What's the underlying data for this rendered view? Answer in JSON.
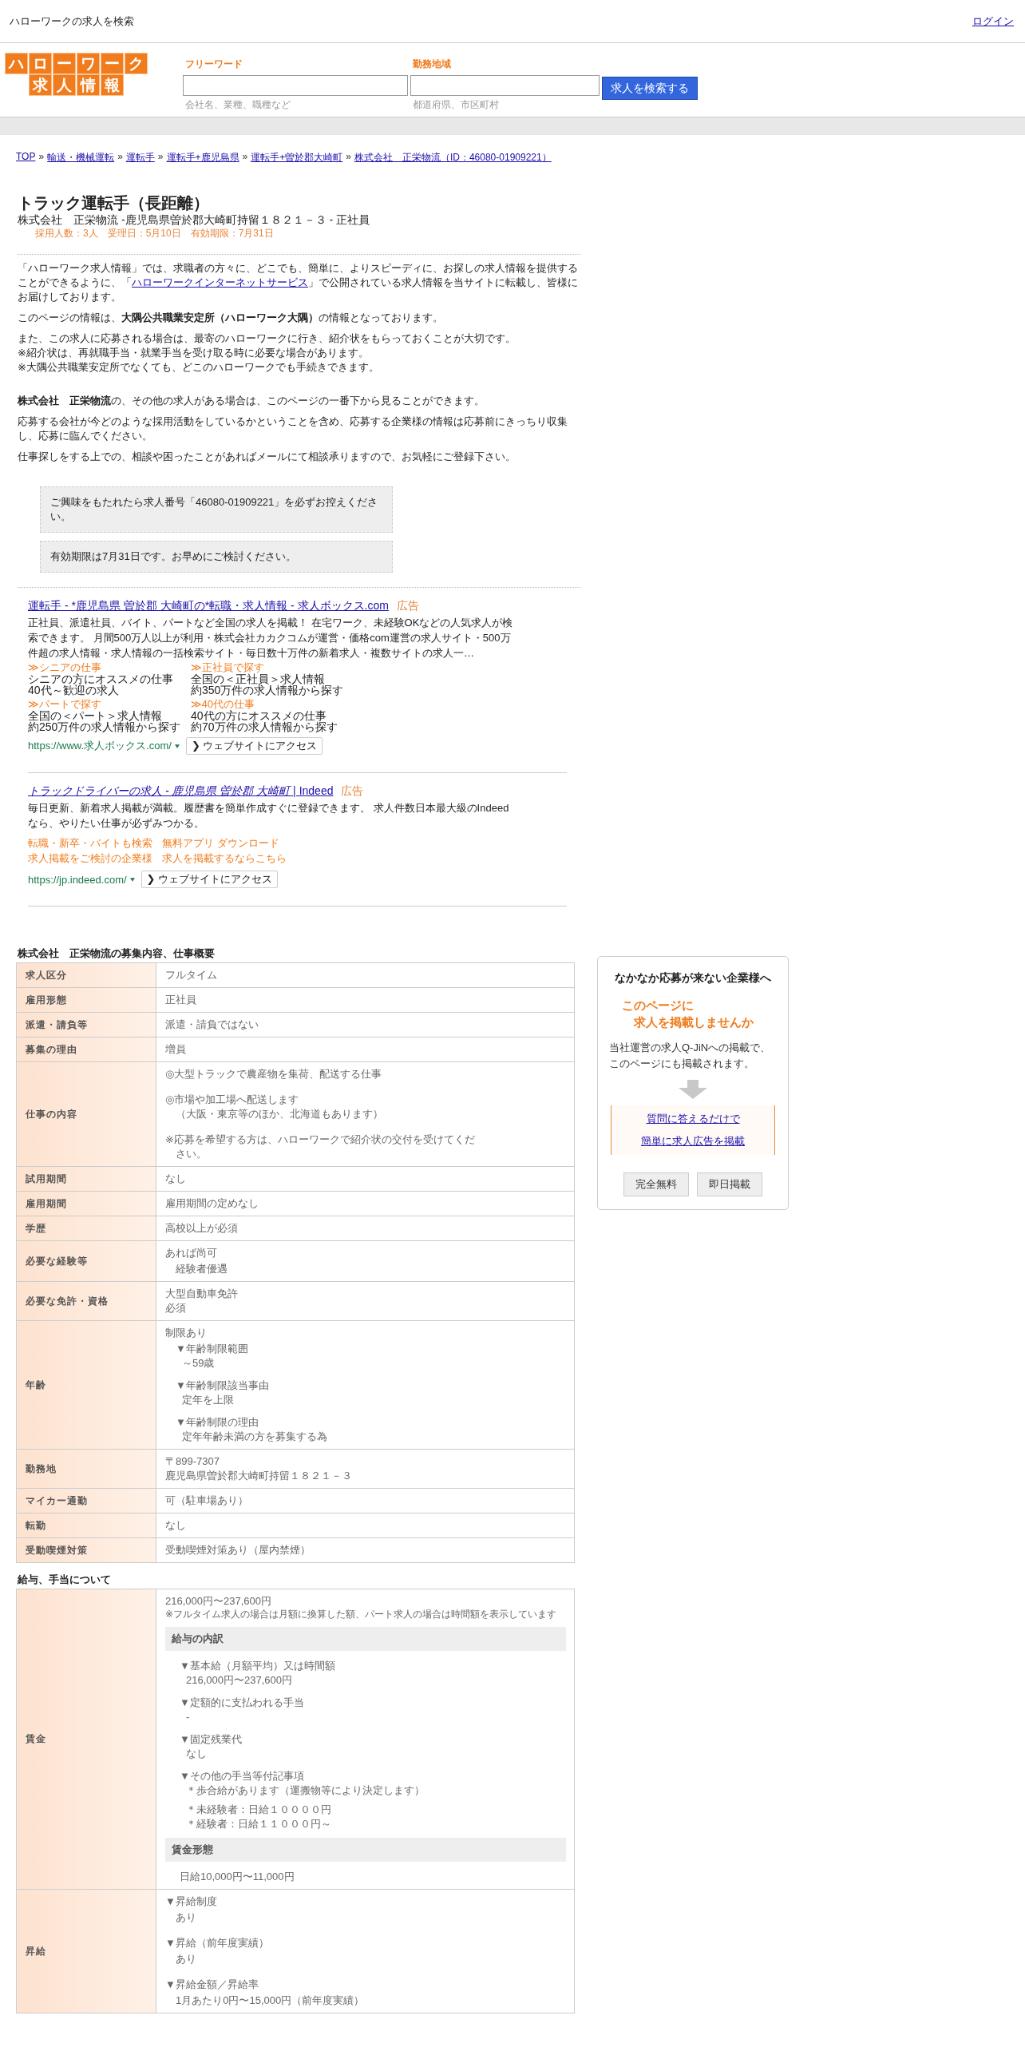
{
  "top_bar": {
    "title": "ハローワークの求人を検索",
    "login": "ログイン"
  },
  "logo": {
    "top": "ハローワーク",
    "bottom": "求人情報"
  },
  "search": {
    "fields": [
      {
        "label": "フリーワード",
        "note": "会社名、業種、職種など"
      },
      {
        "label": "勤務地域",
        "note": "都道府県、市区町村"
      }
    ],
    "button": "求人を検索する"
  },
  "breadcrumb": [
    {
      "kind": "link",
      "text": "TOP"
    },
    {
      "kind": "separator",
      "text": "»"
    },
    {
      "kind": "link",
      "text": "輸送・機械運転"
    },
    {
      "kind": "separator",
      "text": "»"
    },
    {
      "kind": "link",
      "text": "運転手"
    },
    {
      "kind": "separator",
      "text": "»"
    },
    {
      "kind": "link",
      "text": "運転手+鹿児島県"
    },
    {
      "kind": "separator",
      "text": "»"
    },
    {
      "kind": "link",
      "text": "運転手+曽於郡大崎町"
    },
    {
      "kind": "separator",
      "text": "»"
    },
    {
      "kind": "link",
      "text": "株式会社　正栄物流（ID：46080-01909221）"
    }
  ],
  "job": {
    "title": "トラック運転手（長距離）",
    "subtitle": "株式会社　正栄物流 -鹿児島県曽於郡大崎町持留１８２１－３ - 正社員",
    "meta": "採用人数：3人　受理日：5月10日　有効期限：7月31日"
  },
  "intro": [
    [
      {
        "text": "「ハローワーク求人情報」では、求職者の方々に、どこでも、簡単に、よりスピーディに、お探しの求人情報を提供することができるように、「",
        "link": "ハローワークインターネットサービス",
        "after": "」で公開されている求人情報を当サイトに転載し、皆様にお届けしております。"
      },
      {
        "text": "このページの情報は、**大隅公共職業安定所（ハローワーク大隅）**の情報となっております。"
      },
      {
        "lines": [
          "また、この求人に応募される場合は、最寄のハローワークに行き、紹介状をもらっておくことが大切です。",
          "※紹介状は、再就職手当・就業手当を受け取る時に必要な場合があります。",
          "※大隅公共職業安定所でなくても、どこのハローワークでも手続きできます。"
        ]
      }
    ],
    [
      {
        "text": "**株式会社　正栄物流**の、その他の求人がある場合は、このページの一番下から見ることができます。"
      },
      {
        "text": "応募する会社が今どのような採用活動をしているかということを含め、応募する企業様の情報は応募前にきっちり収集し、応募に臨んでください。"
      },
      {
        "text": "仕事探しをする上での、相談や困ったことがあればメールにて相談承りますので、お気軽にご登録下さい。"
      }
    ]
  ],
  "notices": [
    "ご興味をもたれたら求人番号「46080-01909221」を必ずお控えください。",
    "有効期限は7月31日です。お早めにご検討ください。"
  ],
  "ads": [
    {
      "kind": "sitelinks",
      "title": "運転手 - *鹿児島県 曽於郡 大崎町の*転職・求人情報 - 求人ボックス.com",
      "label": "広告",
      "description": "正社員、派遣社員、バイト、パートなど全国の求人を掲載！ 在宅ワーク、未経験OKなどの人気求人が検索できます。 月間500万人以上が利用・株式会社カカクコムが運営・価格com運営の求人サイト・500万件超の求人情報・求人情報の一括検索サイト・毎日数十万件の新着求人・複数サイトの求人一…",
      "sitelinks": [
        {
          "title": "≫シニアの仕事",
          "lines": [
            "シニアの方にオススメの仕事",
            "40代～歓迎の求人"
          ]
        },
        {
          "title": "≫正社員で探す",
          "lines": [
            "全国の＜正社員＞求人情報",
            "約350万件の求人情報から探す"
          ]
        },
        {
          "title": "≫パートで探す",
          "lines": [
            "全国の＜パート＞求人情報",
            "約250万件の求人情報から探す"
          ]
        },
        {
          "title": "≫40代の仕事",
          "lines": [
            "40代の方にオススメの仕事",
            "約70万件の求人情報から探す"
          ]
        }
      ],
      "url": "https://www.求人ボックス.com/",
      "button": "❯ ウェブサイトにアクセス"
    },
    {
      "kind": "links",
      "title": "*トラックドライバーの求人 - 鹿児島県 曽於郡 大崎町* | Indeed",
      "label": "広告",
      "description": "毎日更新、新着求人掲載が満載。履歴書を簡単作成すぐに登録できます。 求人件数日本最大級のIndeedなら、やりたい仕事が必ずみつかる。",
      "links": [
        [
          "転職・新卒・バイトも検索",
          "無料アプリ ダウンロード"
        ],
        [
          "求人掲載をご検討の企業様",
          "求人を掲載するならこちら"
        ]
      ],
      "url": "https://jp.indeed.com/",
      "button": "❯ ウェブサイトにアクセス"
    }
  ],
  "summary": {
    "heading": "株式会社　正栄物流の募集内容、仕事概要",
    "rows": [
      {
        "label": "求人区分",
        "blocks": [
          {
            "text": "フルタイム"
          }
        ]
      },
      {
        "label": "雇用形態",
        "blocks": [
          {
            "text": "正社員"
          }
        ]
      },
      {
        "label": "派遣・請負等",
        "blocks": [
          {
            "text": "派遣・請負ではない"
          }
        ]
      },
      {
        "label": "募集の理由",
        "blocks": [
          {
            "text": "増員"
          }
        ]
      },
      {
        "label": "仕事の内容",
        "blocks": [
          {
            "text": "◎大型トラックで農産物を集荷、配送する仕事"
          },
          {
            "lines": [
              "◎市場や加工場へ配送します",
              "　（大阪・東京等のほか、北海道もあります）"
            ]
          },
          {
            "lines": [
              "※応募を希望する方は、ハローワークで紹介状の交付を受けてくだ",
              "　さい。"
            ]
          }
        ]
      },
      {
        "label": "試用期間",
        "blocks": [
          {
            "text": "なし"
          }
        ]
      },
      {
        "label": "雇用期間",
        "blocks": [
          {
            "text": "雇用期間の定めなし"
          }
        ]
      },
      {
        "label": "学歴",
        "blocks": [
          {
            "text": "高校以上が必須"
          }
        ]
      },
      {
        "label": "必要な経験等",
        "blocks": [
          {
            "text": "あれば尚可",
            "children": [
              {
                "text": "経験者優遇"
              }
            ]
          }
        ]
      },
      {
        "label": "必要な免許・資格",
        "blocks": [
          {
            "lines": [
              "大型自動車免許",
              "必須"
            ]
          }
        ]
      },
      {
        "label": "年齢",
        "blocks": [
          {
            "text": "制限あり",
            "children": [
              {
                "text": "▼年齢制限範囲",
                "children": [
                  {
                    "text": "～59歳"
                  }
                ]
              },
              {
                "text": "▼年齢制限該当事由",
                "children": [
                  {
                    "text": "定年を上限"
                  }
                ]
              },
              {
                "text": "▼年齢制限の理由",
                "children": [
                  {
                    "text": "定年年齢未満の方を募集する為"
                  }
                ]
              }
            ]
          }
        ]
      },
      {
        "label": "勤務地",
        "blocks": [
          {
            "lines": [
              "〒899-7307",
              "鹿児島県曽於郡大崎町持留１８２１－３"
            ]
          }
        ]
      },
      {
        "label": "マイカー通勤",
        "blocks": [
          {
            "text": "可（駐車場あり）"
          }
        ]
      },
      {
        "label": "転勤",
        "blocks": [
          {
            "text": "なし"
          }
        ]
      },
      {
        "label": "受動喫煙対策",
        "blocks": [
          {
            "text": "受動喫煙対策あり（屋内禁煙）"
          }
        ]
      }
    ]
  },
  "salary": {
    "heading": "給与、手当について",
    "rows": [
      {
        "label": "賃金",
        "blocks": [
          {
            "kind": "text",
            "text": "216,000円〜237,600円"
          },
          {
            "kind": "note",
            "text": "※フルタイム求人の場合は月額に換算した額、パート求人の場合は時間額を表示しています"
          },
          {
            "kind": "subheading",
            "text": "給与の内訳",
            "children": [
              {
                "text": "▼基本給（月額平均）又は時間額",
                "children": [
                  {
                    "text": "216,000円〜237,600円"
                  }
                ]
              },
              {
                "text": "▼定額的に支払われる手当",
                "children": [
                  {
                    "text": "-"
                  }
                ]
              },
              {
                "text": "▼固定残業代",
                "children": [
                  {
                    "text": "なし"
                  }
                ]
              },
              {
                "text": "▼その他の手当等付記事項",
                "children": [
                  {
                    "text": "＊歩合給があります（運搬物等により決定します）"
                  },
                  {
                    "lines": [
                      "＊未経験者：日給１００００円",
                      "＊経験者：日給１１０００円～"
                    ]
                  }
                ]
              }
            ]
          },
          {
            "kind": "subheading",
            "text": "賃金形態",
            "children": [
              {
                "text": "日給10,000円〜11,000円"
              }
            ]
          }
        ]
      },
      {
        "label": "昇給",
        "blocks": [
          {
            "text": "▼昇給制度",
            "children": [
              {
                "text": "あり"
              }
            ]
          },
          {
            "text": "▼昇給（前年度実績）",
            "children": [
              {
                "text": "あり"
              }
            ]
          },
          {
            "text": "▼昇給金額／昇給率",
            "children": [
              {
                "text": "1月あたり0円〜15,000円（前年度実績）"
              }
            ]
          }
        ]
      }
    ]
  },
  "sidebar": {
    "title": "なかなか応募が来ない企業様へ",
    "headline": [
      "このページに",
      "求人を掲載しませんか"
    ],
    "text": "当社運営の求人Q-JiNへの掲載で、このページにも掲載されます。",
    "links": [
      "質問に答えるだけで",
      "簡単に求人広告を掲載"
    ],
    "tags": [
      "完全無料",
      "即日掲載"
    ]
  }
}
